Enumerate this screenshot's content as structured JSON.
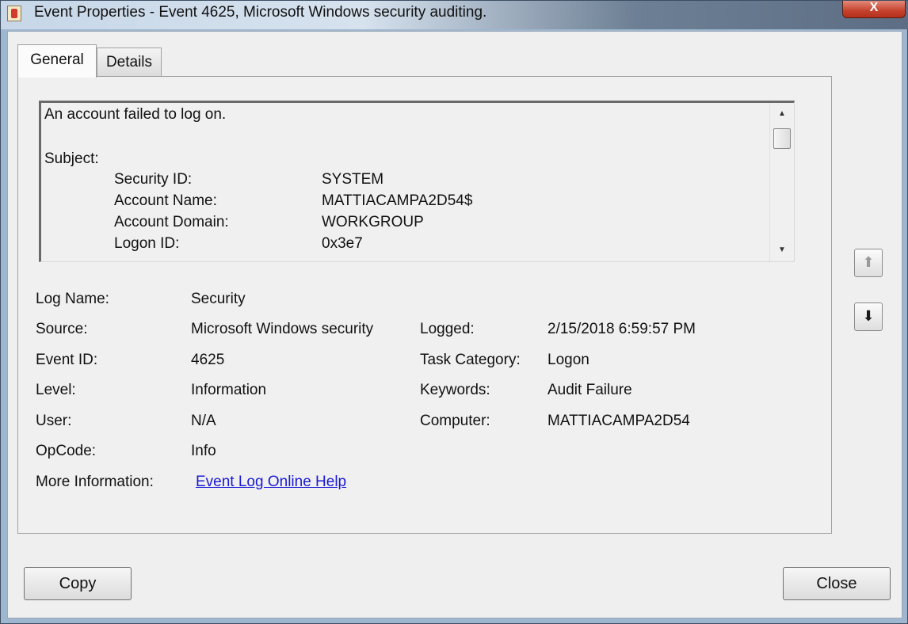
{
  "window": {
    "title": "Event Properties - Event 4625, Microsoft Windows security auditing.",
    "close_glyph": "X"
  },
  "tabs": [
    {
      "label": "General",
      "active": true
    },
    {
      "label": "Details",
      "active": false
    }
  ],
  "description": {
    "intro": "An account failed to log on.",
    "subject_heading": "Subject:",
    "fields": [
      {
        "label": "Security ID:",
        "value": "SYSTEM"
      },
      {
        "label": "Account Name:",
        "value": "MATTIACAMPA2D54$"
      },
      {
        "label": "Account Domain:",
        "value": "WORKGROUP"
      },
      {
        "label": "Logon ID:",
        "value": "0x3e7"
      }
    ],
    "scroll_up_glyph": "▲",
    "scroll_down_glyph": "▼"
  },
  "details": {
    "log_name": {
      "label": "Log Name:",
      "value": "Security"
    },
    "source": {
      "label": "Source:",
      "value": "Microsoft Windows security"
    },
    "event_id": {
      "label": "Event ID:",
      "value": "4625"
    },
    "level": {
      "label": "Level:",
      "value": "Information"
    },
    "user": {
      "label": "User:",
      "value": "N/A"
    },
    "opcode": {
      "label": "OpCode:",
      "value": "Info"
    },
    "more_info": {
      "label": "More Information:",
      "link_text": "Event Log Online Help"
    },
    "logged": {
      "label": "Logged:",
      "value": "2/15/2018 6:59:57 PM"
    },
    "task_category": {
      "label": "Task Category:",
      "value": "Logon"
    },
    "keywords": {
      "label": "Keywords:",
      "value": "Audit Failure"
    },
    "computer": {
      "label": "Computer:",
      "value": "MATTIACAMPA2D54"
    }
  },
  "nav": {
    "up_glyph": "⬆",
    "down_glyph": "⬇"
  },
  "buttons": {
    "copy": "Copy",
    "close": "Close"
  },
  "colors": {
    "link": "#1a1ad4",
    "close_button": "#c4422e"
  }
}
